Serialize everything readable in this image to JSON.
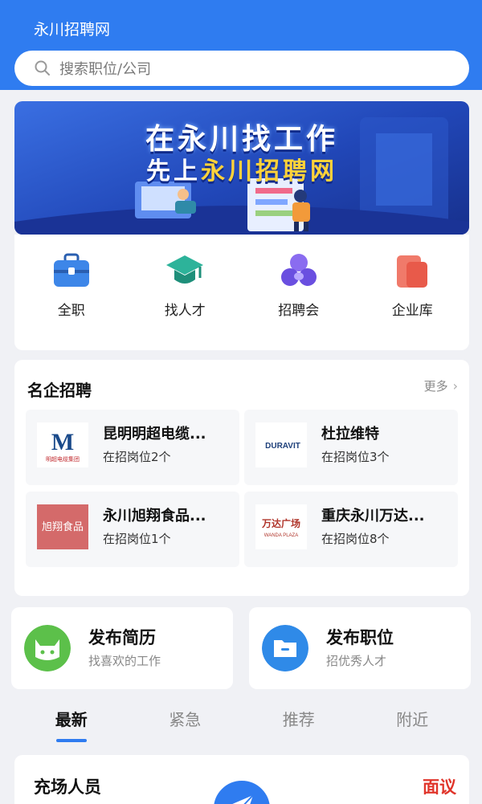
{
  "header": {
    "title": "永川招聘网"
  },
  "search": {
    "placeholder": "搜索职位/公司",
    "icon": "search-icon"
  },
  "banner": {
    "line1": "在永川找工作",
    "line2_prefix": "先上",
    "line2_highlight": "永川招聘网"
  },
  "quick_links": [
    {
      "label": "全职",
      "icon": "briefcase-icon"
    },
    {
      "label": "找人才",
      "icon": "graduation-cap-icon"
    },
    {
      "label": "招聘会",
      "icon": "group-icon"
    },
    {
      "label": "企业库",
      "icon": "building-icon"
    }
  ],
  "companies": {
    "title": "名企招聘",
    "more_label": "更多",
    "items": [
      {
        "name": "昆明明超电缆...",
        "jobs": "在招岗位2个",
        "logo_text": "M",
        "logo_sub": "明超电缆集团"
      },
      {
        "name": "杜拉维特",
        "jobs": "在招岗位3个",
        "logo_text": "DURAVIT"
      },
      {
        "name": "永川旭翔食品...",
        "jobs": "在招岗位1个",
        "logo_text": "旭翔食品"
      },
      {
        "name": "重庆永川万达...",
        "jobs": "在招岗位8个",
        "logo_text": "万达广场",
        "logo_sub": "WANDA PLAZA"
      }
    ]
  },
  "publish": {
    "resume": {
      "title": "发布简历",
      "subtitle": "找喜欢的工作"
    },
    "job": {
      "title": "发布职位",
      "subtitle": "招优秀人才"
    }
  },
  "tabs": [
    {
      "label": "最新",
      "active": true
    },
    {
      "label": "紧急",
      "active": false
    },
    {
      "label": "推荐",
      "active": false
    },
    {
      "label": "附近",
      "active": false
    }
  ],
  "job_card": {
    "title": "充场人员",
    "tag": "面议"
  },
  "colors": {
    "primary": "#2f7cf0",
    "accent_red": "#e0352b",
    "background": "#f0f1f5"
  }
}
